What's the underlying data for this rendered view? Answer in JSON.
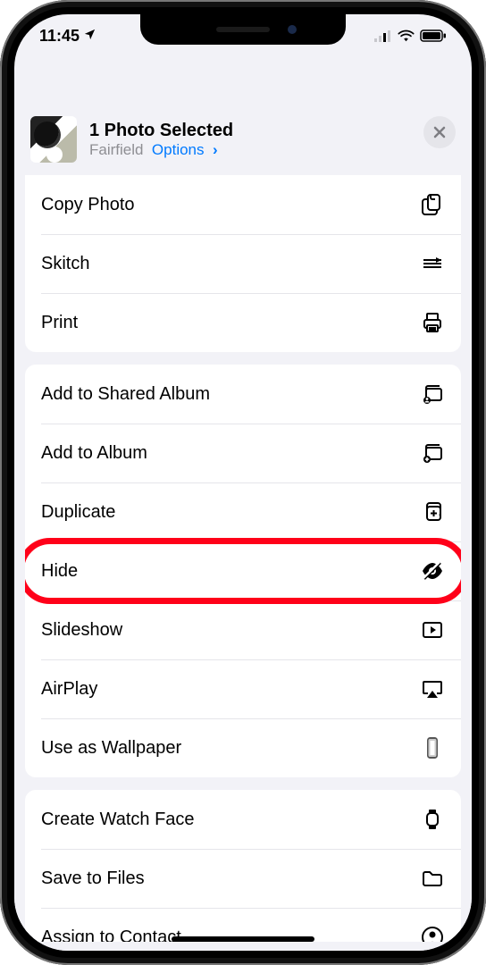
{
  "status": {
    "time": "11:45"
  },
  "header": {
    "title": "1 Photo Selected",
    "location": "Fairfield",
    "options": "Options"
  },
  "groups": [
    {
      "rows": [
        {
          "key": "copy",
          "label": "Copy Photo",
          "icon": "copy-icon"
        },
        {
          "key": "skitch",
          "label": "Skitch",
          "icon": "skitch-icon"
        },
        {
          "key": "print",
          "label": "Print",
          "icon": "print-icon"
        }
      ]
    },
    {
      "rows": [
        {
          "key": "shared",
          "label": "Add to Shared Album",
          "icon": "shared-album-icon"
        },
        {
          "key": "album",
          "label": "Add to Album",
          "icon": "album-icon"
        },
        {
          "key": "duplicate",
          "label": "Duplicate",
          "icon": "duplicate-icon"
        },
        {
          "key": "hide",
          "label": "Hide",
          "icon": "hide-icon",
          "highlighted": true
        },
        {
          "key": "slideshow",
          "label": "Slideshow",
          "icon": "slideshow-icon"
        },
        {
          "key": "airplay",
          "label": "AirPlay",
          "icon": "airplay-icon"
        },
        {
          "key": "wallpaper",
          "label": "Use as Wallpaper",
          "icon": "wallpaper-icon"
        }
      ]
    },
    {
      "rows": [
        {
          "key": "watchface",
          "label": "Create Watch Face",
          "icon": "watchface-icon"
        },
        {
          "key": "files",
          "label": "Save to Files",
          "icon": "files-icon"
        },
        {
          "key": "contact",
          "label": "Assign to Contact",
          "icon": "contact-icon"
        }
      ]
    }
  ]
}
